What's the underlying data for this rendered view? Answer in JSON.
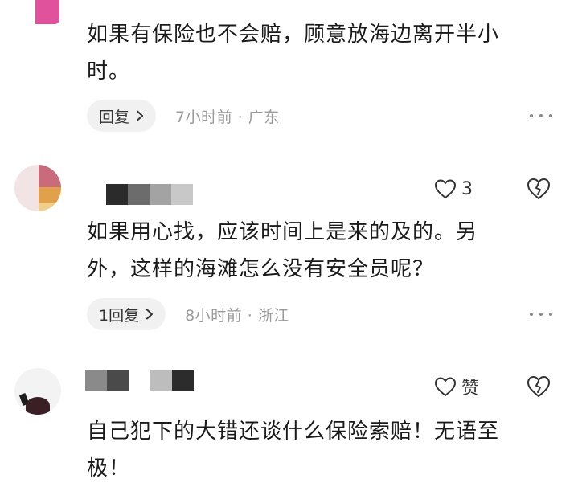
{
  "comments": [
    {
      "text_lines": [
        "如果有保险也不会赔，顾意放海边离开半小",
        "时。"
      ],
      "reply_label": "回复",
      "meta": "7小时前 · 广东",
      "more_icon": "more-icon"
    },
    {
      "text_lines": [
        "如果用心找，应该时间上是来的及的。另",
        "外，这样的海滩怎么没有安全员呢？"
      ],
      "reply_label": "1回复",
      "meta": "8小时前 · 浙江",
      "likes": "3",
      "more_icon": "more-icon"
    },
    {
      "text_lines": [
        "自己犯下的大错还谈什么保险索赔！无语至",
        "极！"
      ],
      "like_label": "赞"
    }
  ],
  "icons": {
    "like": "heart-icon",
    "dislike": "broken-heart-icon",
    "chevron": "chevron-right-icon"
  },
  "colors": {
    "text": "#1a1a1a",
    "meta": "#9a9a9a",
    "pill_bg": "#f1f1f1",
    "avatar_pink": "#e0529c"
  }
}
